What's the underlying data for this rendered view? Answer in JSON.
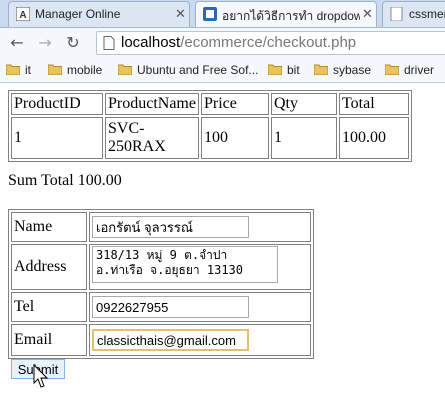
{
  "browser": {
    "tabs": [
      {
        "title": "Manager Online",
        "icon": "manager-online-favicon",
        "active": false
      },
      {
        "title": "อยากได้วิธีการทำ dropdown",
        "icon": "site-favicon",
        "active": true
      },
      {
        "title": "cssmen",
        "icon": "doc-favicon",
        "active": false
      }
    ],
    "url_host": "localhost",
    "url_path": "/ecommerce/checkout.php",
    "bookmarks": [
      "it",
      "mobile",
      "Ubuntu and Free Sof...",
      "bit",
      "sybase",
      "driver"
    ]
  },
  "cart": {
    "headers": [
      "ProductID",
      "ProductName",
      "Price",
      "Qty",
      "Total"
    ],
    "rows": [
      [
        "1",
        "SVC-250RAX",
        "100",
        "1",
        "100.00"
      ]
    ],
    "sum_total": "Sum Total 100.00"
  },
  "form": {
    "name_label": "Name",
    "name_value": "เอกรัตน์ จุลวรรณ์",
    "address_label": "Address",
    "address_value": "318/13 หมู่ 9 ต.จำปา\nอ.ท่าเรือ จ.อยุธยา 13130",
    "tel_label": "Tel",
    "tel_value": "0922627955",
    "email_label": "Email",
    "email_value": "classicthais@gmail.com",
    "submit_label": "Submit"
  }
}
